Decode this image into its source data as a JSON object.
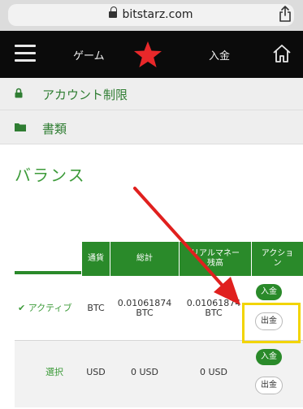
{
  "browser": {
    "url": "bitstarz.com"
  },
  "nav": {
    "game_label": "ゲーム",
    "deposit_label": "入金"
  },
  "menu": [
    {
      "label": "アカウント制限",
      "icon": "lock-icon"
    },
    {
      "label": "書類",
      "icon": "folder-icon"
    }
  ],
  "balance": {
    "title": "バランス",
    "headers": [
      "通貨",
      "総計",
      "リアルマネー残高",
      "アクション"
    ],
    "rows": [
      {
        "status": "アクティブ",
        "currency": "BTC",
        "total": "0.01061874 BTC",
        "real": "0.01061874 BTC",
        "deposit_button": "入金",
        "withdraw_button": "出金"
      },
      {
        "status": "選択",
        "currency": "USD",
        "total": "0 USD",
        "real": "0 USD",
        "deposit_button": "入金",
        "withdraw_button": "出金"
      }
    ]
  },
  "colors": {
    "accent_green": "#2a8a2a",
    "highlight_yellow": "#f2d400",
    "arrow_red": "#e0201e",
    "nav_black": "#0b0b0b",
    "star_red": "#e8282a"
  }
}
